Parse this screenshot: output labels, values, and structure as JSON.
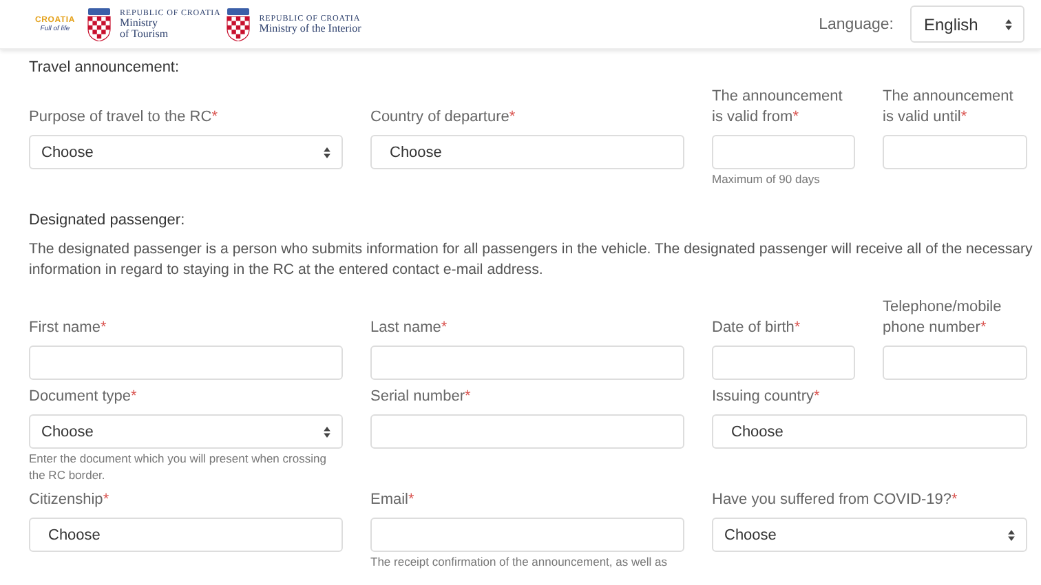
{
  "header": {
    "logo": {
      "word": "CROATIA",
      "tagline": "Full of life"
    },
    "ministries": [
      {
        "country": "REPUBLIC OF CROATIA",
        "lines": [
          "Ministry",
          "of Tourism"
        ]
      },
      {
        "country": "REPUBLIC OF CROATIA",
        "lines": [
          "Ministry of the Interior"
        ]
      }
    ],
    "language": {
      "label": "Language:",
      "value": "English"
    }
  },
  "sections": [
    {
      "title": "Travel announcement:",
      "rows": [
        [
          {
            "label": "Purpose of travel to the RC",
            "marker": "*",
            "kind": "select",
            "value": "Choose",
            "wide": false
          },
          {
            "label": "Country of departure",
            "marker": "*",
            "kind": "combo",
            "value": "Choose",
            "wide": false
          },
          {
            "label": "The announcement is valid from",
            "marker": "*",
            "kind": "text",
            "hint": "Maximum of 90 days",
            "wide": false
          },
          {
            "label": "The announcement is valid until",
            "marker": "*",
            "kind": "text",
            "wide": false
          }
        ]
      ]
    },
    {
      "title": "Designated passenger:",
      "description": "The designated passenger is a person who submits information for all passengers in the vehicle. The designated passenger will receive all of the necessary information in regard to staying in the RC at the entered contact e-mail address.",
      "rows": [
        [
          {
            "label": "First name",
            "marker": "*",
            "kind": "text",
            "wide": false
          },
          {
            "label": "Last name",
            "marker": "*",
            "kind": "text",
            "wide": false
          },
          {
            "label": "Date of birth",
            "marker": "*",
            "kind": "text",
            "wide": false
          },
          {
            "label": "Telephone/mobile phone number",
            "marker": "*",
            "kind": "text",
            "wide": false
          }
        ],
        [
          {
            "label": "Document type",
            "marker": "*",
            "kind": "select",
            "value": "Choose",
            "hint": "Enter the document which you will present when crossing the RC border.",
            "wide": false
          },
          {
            "label": "Serial number",
            "marker": "*",
            "kind": "text",
            "wide": false
          },
          {
            "label": "Issuing country",
            "marker": "*",
            "kind": "combo",
            "value": "Choose",
            "wide": true
          }
        ],
        [
          {
            "label": "Citizenship",
            "marker": "*",
            "kind": "combo",
            "value": "Choose",
            "wide": false
          },
          {
            "label": "Email",
            "marker": "*",
            "kind": "text",
            "hint": "The receipt confirmation of the announcement, as well as",
            "wide": false
          },
          {
            "label": "Have you suffered from COVID-19?",
            "marker": "*",
            "kind": "select",
            "value": "Choose",
            "wide": true
          }
        ]
      ]
    }
  ]
}
